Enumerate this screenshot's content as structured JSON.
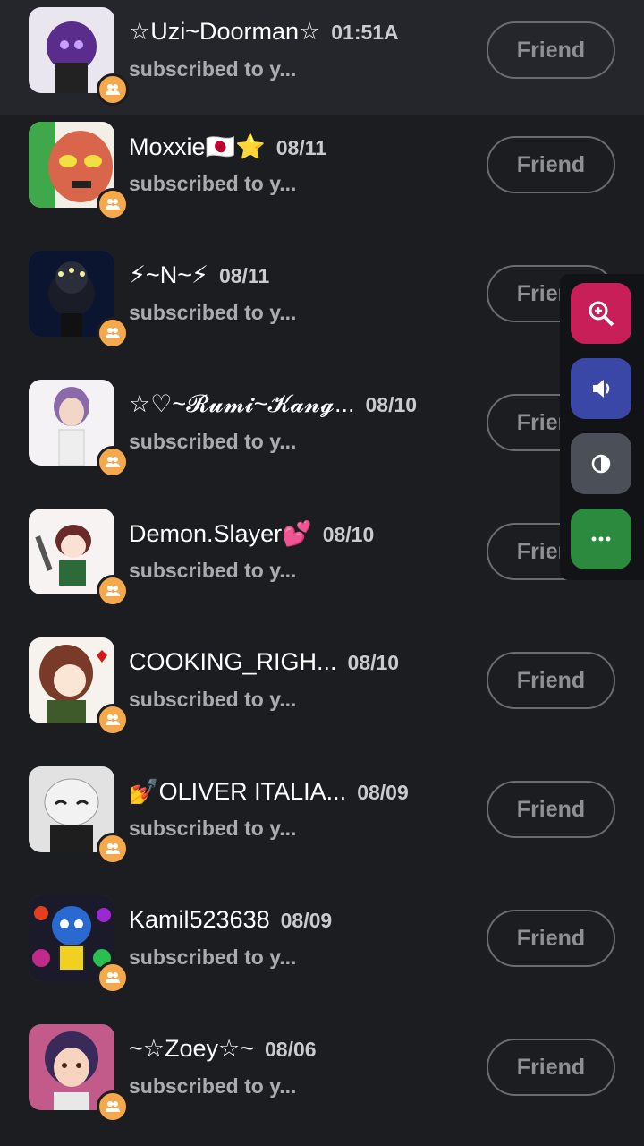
{
  "subscribed_text": "subscribed to y...",
  "friend_label": "Friend",
  "rows": [
    {
      "name": "☆Uzi~Doorman☆",
      "date": "01:51A",
      "avatar_color": "#6b3fa0",
      "highlight": true
    },
    {
      "name": "Moxxie🇯🇵⭐",
      "date": "08/11",
      "avatar_color": "#d96a4a"
    },
    {
      "name": "⚡~N~⚡",
      "date": "08/11",
      "avatar_color": "#0b1530"
    },
    {
      "name": "☆♡~𝓡𝓾𝓶𝓲~𝓚𝓪𝓷𝓰...",
      "date": "08/10",
      "avatar_color": "#e8e4ec"
    },
    {
      "name": "Demon.Slayer💕",
      "date": "08/10",
      "avatar_color": "#f2eeee"
    },
    {
      "name": "COOKING_RIGH...",
      "date": "08/10",
      "avatar_color": "#f4f1ee"
    },
    {
      "name": "💅OLIVER ITALIA...",
      "date": "08/09",
      "avatar_color": "#d8d8d8"
    },
    {
      "name": "Kamil523638",
      "date": "08/09",
      "avatar_color": "#2a6ad0"
    },
    {
      "name": "~☆Zoey☆~",
      "date": "08/06",
      "avatar_color": "#c25a8a"
    }
  ],
  "tools": [
    {
      "icon": "zoom-in-icon",
      "color": "#c81f59"
    },
    {
      "icon": "speaker-icon",
      "color": "#3a47a6"
    },
    {
      "icon": "contrast-icon",
      "color": "#4a4f58"
    },
    {
      "icon": "more-icon",
      "color": "#2b8a3e"
    }
  ]
}
